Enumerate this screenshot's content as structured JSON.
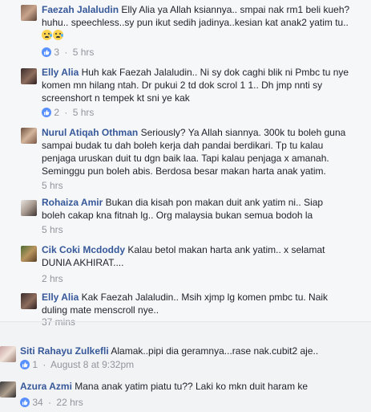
{
  "comments": [
    {
      "author": "Faezah Jalaludin",
      "text": "Elly Alia ya Allah ksiannya.. smpai nak rm1 beli kueh? huhu.. speechless..sy pun ikut sedih jadinya..kesian kat anak2 yatim tu..",
      "emoji_names": [
        "crying-face-icon",
        "crying-face-icon"
      ],
      "reaction_icon": "like-icon",
      "reaction_count": "3",
      "time": "5 hrs"
    },
    {
      "author": "Elly Alia",
      "text": "Huh kak Faezah Jalaludin.. Ni sy dok caghi blik ni Pmbc tu nye komen mn hilang ntah. Dr pukui 2 td dok scrol 1 1.. Dh jmp nnti sy screenshort n tempek kt sni ye kak",
      "reaction_icon": "like-icon",
      "reaction_count": "2",
      "time": "5 hrs"
    },
    {
      "author": "Nurul Atiqah Othman",
      "text": "Seriously? Ya Allah siannya. 300k tu boleh guna sampai budak tu dah boleh kerja dah pandai berdikari. Tp tu kalau penjaga uruskan duit tu dgn baik laa. Tapi kalau penjaga x amanah. Seminggu pun boleh abis. Berdosa besar makan harta anak yatim.",
      "time": "5 hrs"
    },
    {
      "author": "Rohaiza Amir",
      "text": "Bukan dia kisah pon makan duit ank yatim ni.. Siap boleh cakap kna fitnah lg.. Org malaysia bukan semua bodoh la",
      "time": "5 hrs"
    },
    {
      "author": "Cik Coki Mcdoddy",
      "text": "Kalau betol makan harta ank yatim.. x selamat DUNIA AKHIRAT....",
      "time": "2 hrs"
    },
    {
      "author": "Elly Alia",
      "text": "Kak Faezah Jalaludin.. Msih xjmp lg komen pmbc tu. Naik duling mate menscroll nye..",
      "time": "37 mins"
    },
    {
      "author": "Siti Rahayu Zulkefli",
      "text": "Alamak..pipi dia geramnya...rase nak.cubit2 aje..",
      "reaction_icon": "like-icon",
      "reaction_count": "1",
      "time": "August 8 at 9:32pm"
    },
    {
      "author": "Azura Azmi",
      "text": "Mana anak yatim piatu tu?? Laki ko mkn duit haram ke",
      "reaction_icon": "like-icon",
      "reaction_count": "34",
      "time": "22 hrs"
    }
  ],
  "separator": "·",
  "colors": {
    "author_link": "#365899",
    "meta_gray": "#90949c",
    "like_blue": "#5890ff",
    "reply_bg": "#f6f7f9",
    "page_bg": "#f2f3f5"
  }
}
